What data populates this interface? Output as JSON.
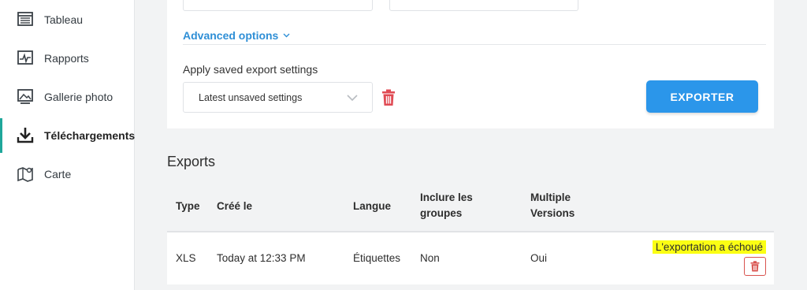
{
  "sidebar": {
    "items": [
      {
        "label": "Tableau",
        "icon": "table-icon"
      },
      {
        "label": "Rapports",
        "icon": "reports-icon"
      },
      {
        "label": "Gallerie photo",
        "icon": "photo-gallery-icon"
      },
      {
        "label": "Téléchargements",
        "icon": "download-icon",
        "active": true
      },
      {
        "label": "Carte",
        "icon": "map-icon"
      }
    ],
    "accent": "#1fa79b"
  },
  "panel": {
    "advanced_options": "Advanced options",
    "apply_label": "Apply saved export settings",
    "saved_settings_value": "Latest unsaved settings",
    "export_button": "EXPORTER"
  },
  "exports": {
    "title": "Exports",
    "headers": {
      "type": "Type",
      "created": "Créé le",
      "language": "Langue",
      "groups": "Inclure les groupes",
      "versions": "Multiple Versions"
    },
    "rows": [
      {
        "type": "XLS",
        "created": "Today at 12:33 PM",
        "language": "Étiquettes",
        "groups": "Non",
        "versions": "Oui",
        "status": "L'exportation a échoué"
      }
    ]
  },
  "colors": {
    "primary": "#2b96ea",
    "link": "#2f8fd6",
    "danger": "#d9534f",
    "highlight": "#fbff14"
  }
}
